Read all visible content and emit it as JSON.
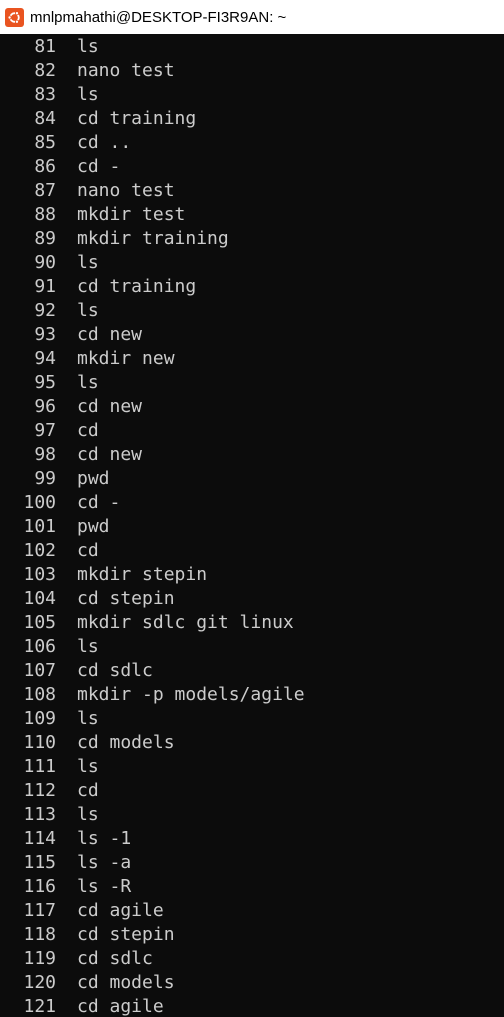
{
  "window": {
    "title": "mnlpmahathi@DESKTOP-FI3R9AN: ~",
    "icon": "ubuntu-icon",
    "icon_color": "#e95420"
  },
  "terminal": {
    "background": "#0c0c0c",
    "foreground": "#cccccc",
    "history": [
      {
        "num": "81",
        "cmd": "ls"
      },
      {
        "num": "82",
        "cmd": "nano test"
      },
      {
        "num": "83",
        "cmd": "ls"
      },
      {
        "num": "84",
        "cmd": "cd training"
      },
      {
        "num": "85",
        "cmd": "cd .."
      },
      {
        "num": "86",
        "cmd": "cd -"
      },
      {
        "num": "87",
        "cmd": "nano test"
      },
      {
        "num": "88",
        "cmd": "mkdir test"
      },
      {
        "num": "89",
        "cmd": "mkdir training"
      },
      {
        "num": "90",
        "cmd": "ls"
      },
      {
        "num": "91",
        "cmd": "cd training"
      },
      {
        "num": "92",
        "cmd": "ls"
      },
      {
        "num": "93",
        "cmd": "cd new"
      },
      {
        "num": "94",
        "cmd": "mkdir new"
      },
      {
        "num": "95",
        "cmd": "ls"
      },
      {
        "num": "96",
        "cmd": "cd new"
      },
      {
        "num": "97",
        "cmd": "cd"
      },
      {
        "num": "98",
        "cmd": "cd new"
      },
      {
        "num": "99",
        "cmd": "pwd"
      },
      {
        "num": "100",
        "cmd": "cd -"
      },
      {
        "num": "101",
        "cmd": "pwd"
      },
      {
        "num": "102",
        "cmd": "cd"
      },
      {
        "num": "103",
        "cmd": "mkdir stepin"
      },
      {
        "num": "104",
        "cmd": "cd stepin"
      },
      {
        "num": "105",
        "cmd": "mkdir sdlc git linux"
      },
      {
        "num": "106",
        "cmd": "ls"
      },
      {
        "num": "107",
        "cmd": "cd sdlc"
      },
      {
        "num": "108",
        "cmd": "mkdir -p models/agile"
      },
      {
        "num": "109",
        "cmd": "ls"
      },
      {
        "num": "110",
        "cmd": "cd models"
      },
      {
        "num": "111",
        "cmd": "ls"
      },
      {
        "num": "112",
        "cmd": "cd"
      },
      {
        "num": "113",
        "cmd": "ls"
      },
      {
        "num": "114",
        "cmd": "ls -1"
      },
      {
        "num": "115",
        "cmd": "ls -a"
      },
      {
        "num": "116",
        "cmd": "ls -R"
      },
      {
        "num": "117",
        "cmd": "cd agile"
      },
      {
        "num": "118",
        "cmd": "cd stepin"
      },
      {
        "num": "119",
        "cmd": "cd sdlc"
      },
      {
        "num": "120",
        "cmd": "cd models"
      },
      {
        "num": "121",
        "cmd": "cd agile"
      }
    ]
  }
}
